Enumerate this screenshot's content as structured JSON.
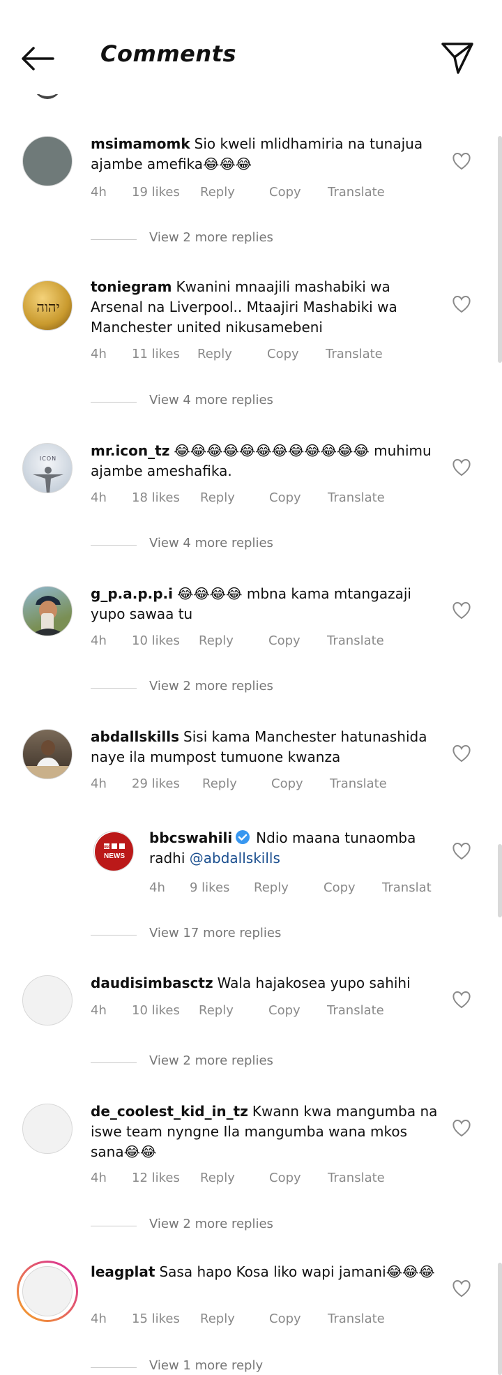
{
  "header": {
    "title": "Comments"
  },
  "colors": {
    "accent_link": "#1b4f8f",
    "meta_gray": "#8a8a8a",
    "verified_blue": "#3897f0",
    "story_ring_start": "#f5a623",
    "story_ring_end": "#d6249f"
  },
  "comments": [
    {
      "username": "msimamomk",
      "text": "Sio kweli mlidhamiria na tunajua ajambe amefika😂😂😂",
      "time": "4h",
      "likes": "19 likes",
      "reply": "Reply",
      "copy": "Copy",
      "translate": "Translate",
      "view_replies": "View 2 more replies",
      "avatar_icon": "gray-circle"
    },
    {
      "username": "toniegram",
      "text": "Kwanini mnaajili mashabiki wa Arsenal na Liverpool.. Mtaajiri Mashabiki wa Manchester united nikusamebeni",
      "time": "4h",
      "likes": "11 likes",
      "reply": "Reply",
      "copy": "Copy",
      "translate": "Translate",
      "view_replies": "View 4 more replies",
      "avatar_icon": "gold-hebrew-medallion",
      "avatar_text": "יהוה"
    },
    {
      "username": "mr.icon_tz",
      "text": "😂😂😂😂😂😂😂😂😂😂😂😂 muhimu ajambe ameshafika.",
      "time": "4h",
      "likes": "18 likes",
      "reply": "Reply",
      "copy": "Copy",
      "translate": "Translate",
      "view_replies": "View 4 more replies",
      "avatar_icon": "icon-statue",
      "avatar_text": "ICON"
    },
    {
      "username": "g_p.a.p.p.i",
      "text": "😂😂😂😂 mbna kama mtangazaji yupo sawaa tu",
      "time": "4h",
      "likes": "10 likes",
      "reply": "Reply",
      "copy": "Copy",
      "translate": "Translate",
      "view_replies": "View 2 more replies",
      "avatar_icon": "person-cap-selfie"
    },
    {
      "username": "abdallskills",
      "text": "Sisi kama Manchester hatunashida naye ila mumpost tumuone kwanza",
      "time": "4h",
      "likes": "29 likes",
      "reply": "Reply",
      "copy": "Copy",
      "translate": "Translate",
      "avatar_icon": "person-portrait"
    },
    {
      "username": "bbcswahili",
      "verified": true,
      "text": "Ndio maana tunaomba radhi",
      "mention": "@abdallskills",
      "time": "4h",
      "likes": "9 likes",
      "reply": "Reply",
      "copy": "Copy",
      "translate": "Translat",
      "view_replies": "View 17 more replies",
      "avatar_icon": "bbc-news-logo",
      "avatar_text": [
        "BBC",
        "NEWS"
      ]
    },
    {
      "username": "daudisimbasctz",
      "text": "Wala hajakosea yupo sahihi",
      "time": "4h",
      "likes": "10 likes",
      "reply": "Reply",
      "copy": "Copy",
      "translate": "Translate",
      "view_replies": "View 2 more replies",
      "avatar_icon": "blank-avatar"
    },
    {
      "username": "de_coolest_kid_in_tz",
      "text": "Kwann kwa mangumba na iswe team nyngne Ila mangumba wana mkos sana😂😂",
      "time": "4h",
      "likes": "12 likes",
      "reply": "Reply",
      "copy": "Copy",
      "translate": "Translate",
      "view_replies": "View 2 more replies",
      "avatar_icon": "blank-avatar"
    },
    {
      "username": "leagplat",
      "text": "Sasa hapo Kosa liko wapi jamani😂😂😂",
      "time": "4h",
      "likes": "15 likes",
      "reply": "Reply",
      "copy": "Copy",
      "translate": "Translate",
      "view_replies": "View 1 more reply",
      "avatar_icon": "blank-avatar-story-ring"
    }
  ]
}
